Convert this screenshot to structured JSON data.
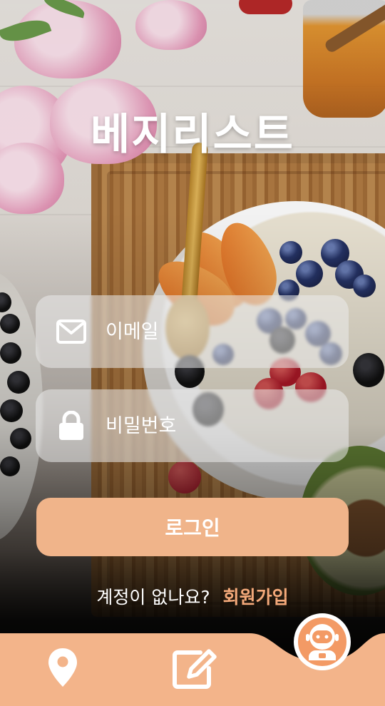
{
  "app": {
    "title": "베지리스트"
  },
  "login_form": {
    "email_placeholder": "이메일",
    "password_placeholder": "비밀번호",
    "login_button_label": "로그인"
  },
  "signup": {
    "prompt": "계정이 없나요?",
    "link_label": "회원가입"
  },
  "bottom_nav": {
    "items": [
      {
        "icon": "map-pin-icon"
      },
      {
        "icon": "edit-icon"
      },
      {
        "icon": "robot-icon"
      }
    ]
  },
  "colors": {
    "accent": "#f0b48a",
    "link": "#f4a97a",
    "nav_bg": "#f3b48a",
    "nav_active": "#f39a65"
  }
}
